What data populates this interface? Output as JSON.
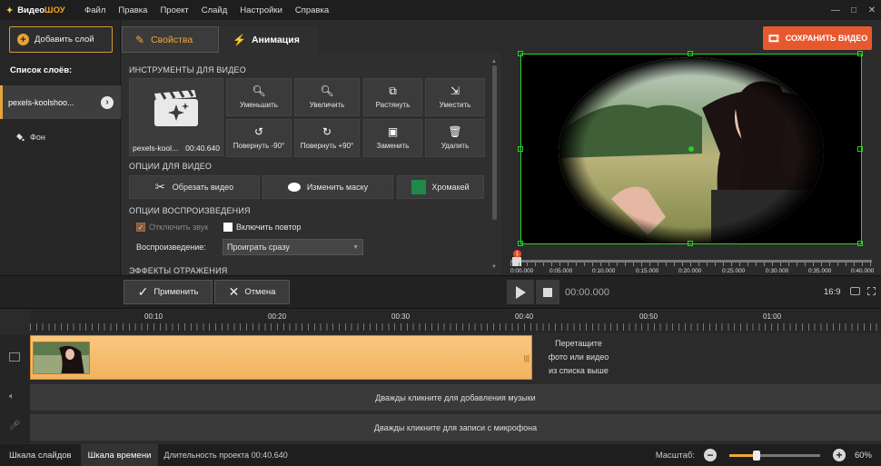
{
  "titlebar": {
    "app_name_part1": "Видео",
    "app_name_part2": "ШОУ",
    "menu": [
      "Файл",
      "Правка",
      "Проект",
      "Слайд",
      "Настройки",
      "Справка"
    ],
    "window_buttons": [
      "—",
      "□",
      "✕"
    ]
  },
  "left": {
    "add_layer": "Добавить слой",
    "layers_title": "Список слоёв:",
    "layers": [
      {
        "label": "pexels-koolshoo...",
        "icon": "video-layer-icon"
      },
      {
        "label": "Фон",
        "icon": "paint-bucket-icon"
      }
    ]
  },
  "tabs": {
    "properties": "Свойства",
    "animation": "Анимация"
  },
  "tools": {
    "title": "ИНСТРУМЕНТЫ ДЛЯ ВИДЕО",
    "thumb_name": "pexels-kool...",
    "thumb_duration": "00:40.640",
    "buttons": [
      {
        "label": "Уменьшить",
        "icon": "zoom-out-icon"
      },
      {
        "label": "Увеличить",
        "icon": "zoom-in-icon"
      },
      {
        "label": "Растянуть",
        "icon": "stretch-icon"
      },
      {
        "label": "Уместить",
        "icon": "fit-icon"
      },
      {
        "label": "Повернуть -90°",
        "icon": "rotate-left-icon"
      },
      {
        "label": "Повернуть +90°",
        "icon": "rotate-right-icon"
      },
      {
        "label": "Заменить",
        "icon": "replace-icon"
      },
      {
        "label": "Удалить",
        "icon": "trash-icon"
      }
    ]
  },
  "video_options": {
    "title": "ОПЦИИ ДЛЯ ВИДЕО",
    "trim": "Обрезать видео",
    "mask": "Изменить маску",
    "chroma": "Хромакей",
    "chroma_color": "#1e8a4a"
  },
  "playback": {
    "title": "ОПЦИИ ВОСПРОИЗВЕДЕНИЯ",
    "mute": "Отключить звук",
    "loop": "Включить повтор",
    "playback_label": "Воспроизведение:",
    "playback_value": "Проиграть сразу"
  },
  "reflection_title": "ЭФФЕКТЫ ОТРАЖЕНИЯ",
  "preview": {
    "save": "СОХРАНИТЬ ВИДЕО",
    "marker": "1",
    "ticks": [
      "0:00.000",
      "0:05.000",
      "0:10.000",
      "0:15.000",
      "0:20.000",
      "0:25.000",
      "0:30.000",
      "0:35.000",
      "0:40.000"
    ]
  },
  "controls": {
    "apply": "Применить",
    "cancel": "Отмена",
    "timecode": "00:00.000",
    "aspect": "16:9"
  },
  "timeline": {
    "ruler": [
      "00:10",
      "00:20",
      "00:30",
      "00:40",
      "00:50",
      "01:00"
    ],
    "drop_hint_1": "Перетащите",
    "drop_hint_2": "фото или видео",
    "drop_hint_3": "из списка выше",
    "music_hint": "Дважды кликните для добавления музыки",
    "mic_hint": "Дважды кликните для записи с микрофона"
  },
  "status": {
    "slides": "Шкала слайдов",
    "timeline": "Шкала времени",
    "duration": "Длительность проекта 00:40.640",
    "zoom_label": "Масштаб:",
    "zoom_value": "60%"
  },
  "colors": {
    "accent": "#e8a33c",
    "save": "#e8582e",
    "selection": "#2ad12a"
  }
}
